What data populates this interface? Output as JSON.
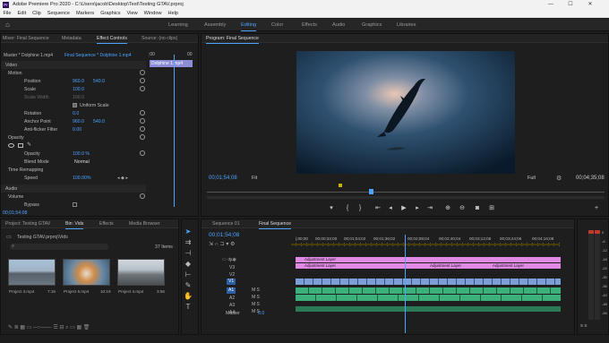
{
  "window": {
    "title": "Adobe Premiere Pro 2020 - C:\\Users\\jacob\\Desktop\\Test\\Testing GTAV.prproj",
    "app_icon": "Pr",
    "minimize": "—",
    "maximize": "☐",
    "close": "✕"
  },
  "menu": [
    "File",
    "Edit",
    "Clip",
    "Sequence",
    "Markers",
    "Graphics",
    "View",
    "Window",
    "Help"
  ],
  "workspaces": [
    "Learning",
    "Assembly",
    "Editing",
    "Color",
    "Effects",
    "Audio",
    "Graphics",
    "Libraries"
  ],
  "workspace_active": "Editing",
  "source_tabs": {
    "mixer": "Mixer: Final Sequence",
    "metadata": "Metadata",
    "effect_controls": "Effect Controls",
    "source": "Source: (no clips)"
  },
  "effect_controls": {
    "master": "Master * Dolphine 1.mp4",
    "sequence": "Final Sequence * Dolphine 1.mp4",
    "ruler_start": ";00",
    "ruler_end": "00",
    "clip_bar": "Dolphine 1.mp4",
    "video_label": "Video",
    "motion": "Motion",
    "position_label": "Position",
    "position_x": "960.0",
    "position_y": "540.0",
    "scale_label": "Scale",
    "scale_val": "100.0",
    "scale_width_label": "Scale Width",
    "scale_width_val": "100.0",
    "uniform_scale": "Uniform Scale",
    "rotation_label": "Rotation",
    "rotation_val": "0.0",
    "anchor_label": "Anchor Point",
    "anchor_x": "960.0",
    "anchor_y": "540.0",
    "antiflicker_label": "Anti-flicker Filter",
    "antiflicker_val": "0.00",
    "opacity": "Opacity",
    "opacity_label": "Opacity",
    "opacity_val": "100.0 %",
    "blend_label": "Blend Mode",
    "blend_val": "Normal",
    "time_remap": "Time Remapping",
    "speed_label": "Speed",
    "speed_val": "100.00%",
    "audio_label": "Audio",
    "volume": "Volume",
    "bypass_label": "Bypass",
    "timecode": "00;01;54;08"
  },
  "program": {
    "tab": "Program: Final Sequence",
    "timecode": "00;01;54;08",
    "fit": "Fit",
    "quality": "Full",
    "duration": "00;04;35;08"
  },
  "project": {
    "tab_project": "Project: Testing GTAV",
    "tab_bin": "Bin: Vids",
    "tab_effects": "Effects",
    "tab_browser": "Media Browser",
    "path": "Testing GTAV.prproj\\Vids",
    "items_count": "37 Items",
    "thumbs": [
      {
        "name": "Project 3.mp4",
        "dur": "7:16"
      },
      {
        "name": "Project 5.mp4",
        "dur": "10:19"
      },
      {
        "name": "Project 4.mp4",
        "dur": "3:56"
      }
    ]
  },
  "timeline": {
    "tab_seq1": "Sequence 01",
    "tab_final": "Final Sequence",
    "timecode": "00;01;54;08",
    "ruler": [
      "|;00;00",
      "00;00;32;00",
      "00;01;04;02",
      "00;01;36;02",
      "00;02;08;04",
      "00;02;40;04",
      "00;03;12;06",
      "00;03;44;06",
      "00;04;16;08"
    ],
    "tracks_video": [
      "V4",
      "V3",
      "V2",
      "V1"
    ],
    "tracks_audio": [
      "A1",
      "A2",
      "A3",
      "A4"
    ],
    "master_label": "Master",
    "master_val": "0.0",
    "adjustment_label": "Adjustment Layer"
  },
  "meter": {
    "scale": [
      "0",
      "-6",
      "-12",
      "-18",
      "-24",
      "-30",
      "-36",
      "-42",
      "-48",
      "-54"
    ],
    "footer": "S  S"
  },
  "colors": {
    "accent": "#4da3ff",
    "adjustment": "#e08ae6",
    "video_clip": "#7b9fd6",
    "audio_clip": "#3bb07a",
    "playhead": "#4da3ff"
  }
}
